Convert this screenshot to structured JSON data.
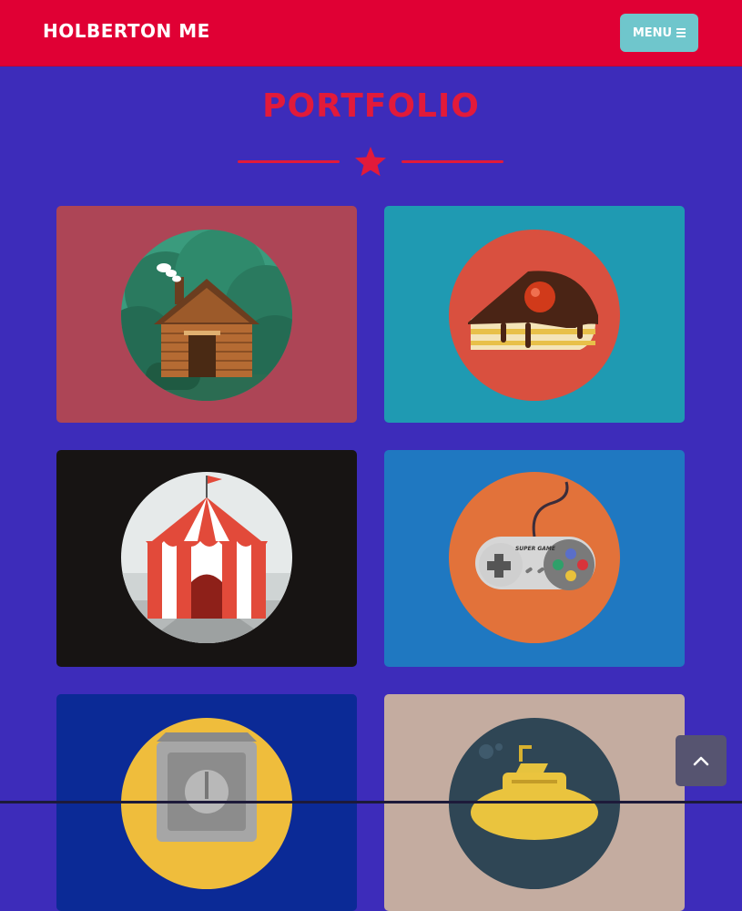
{
  "navbar": {
    "brand": "HOLBERTON ME",
    "menu_label": "MENU",
    "menu_icon": "bars-icon",
    "background": "#e00034"
  },
  "portfolio": {
    "title": "PORTFOLIO",
    "divider_icon": "star-icon",
    "accent": "#e21a3a",
    "items": [
      {
        "icon": "cabin-icon",
        "background": "#ad4556",
        "circle": "#3a9b7d"
      },
      {
        "icon": "cake-icon",
        "background": "#1f9ab2",
        "circle": "#d9503f"
      },
      {
        "icon": "circus-icon",
        "background": "#171413",
        "circle": "#e6eaea"
      },
      {
        "icon": "game-controller-icon",
        "background": "#1f78c1",
        "circle": "#e2723a",
        "text": "SUPER GAME"
      },
      {
        "icon": "safe-icon",
        "background": "#0b2a96",
        "circle": "#efbd3c"
      },
      {
        "icon": "submarine-icon",
        "background": "#c4aca0",
        "circle": "#2f4655"
      }
    ]
  },
  "scroll_top": {
    "icon": "chevron-up-icon"
  },
  "page_background": "#3d2cba"
}
